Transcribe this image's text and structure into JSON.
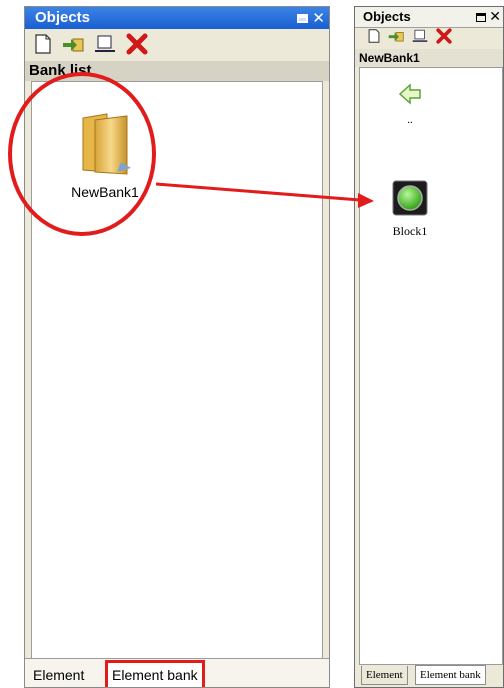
{
  "left_panel": {
    "title": "Objects",
    "section_label": "Bank list",
    "bank_item_label": "NewBank1",
    "tabs": [
      "Element",
      "Element bank"
    ]
  },
  "right_panel": {
    "title": "Objects",
    "section_label": "NewBank1",
    "up_label": "..",
    "block_label": "Block1",
    "tabs": [
      "Element",
      "Element bank"
    ]
  },
  "colors": {
    "annotation": "#e21b1b",
    "titlebar_blue": "#1a5fd1",
    "block_green": "#5fcf3a"
  },
  "icons": {
    "toolbar": [
      "new-document-icon",
      "import-icon",
      "rename-icon",
      "delete-icon"
    ],
    "bank": "folder-icon",
    "up": "back-arrow-icon",
    "block": "green-lamp-icon"
  }
}
